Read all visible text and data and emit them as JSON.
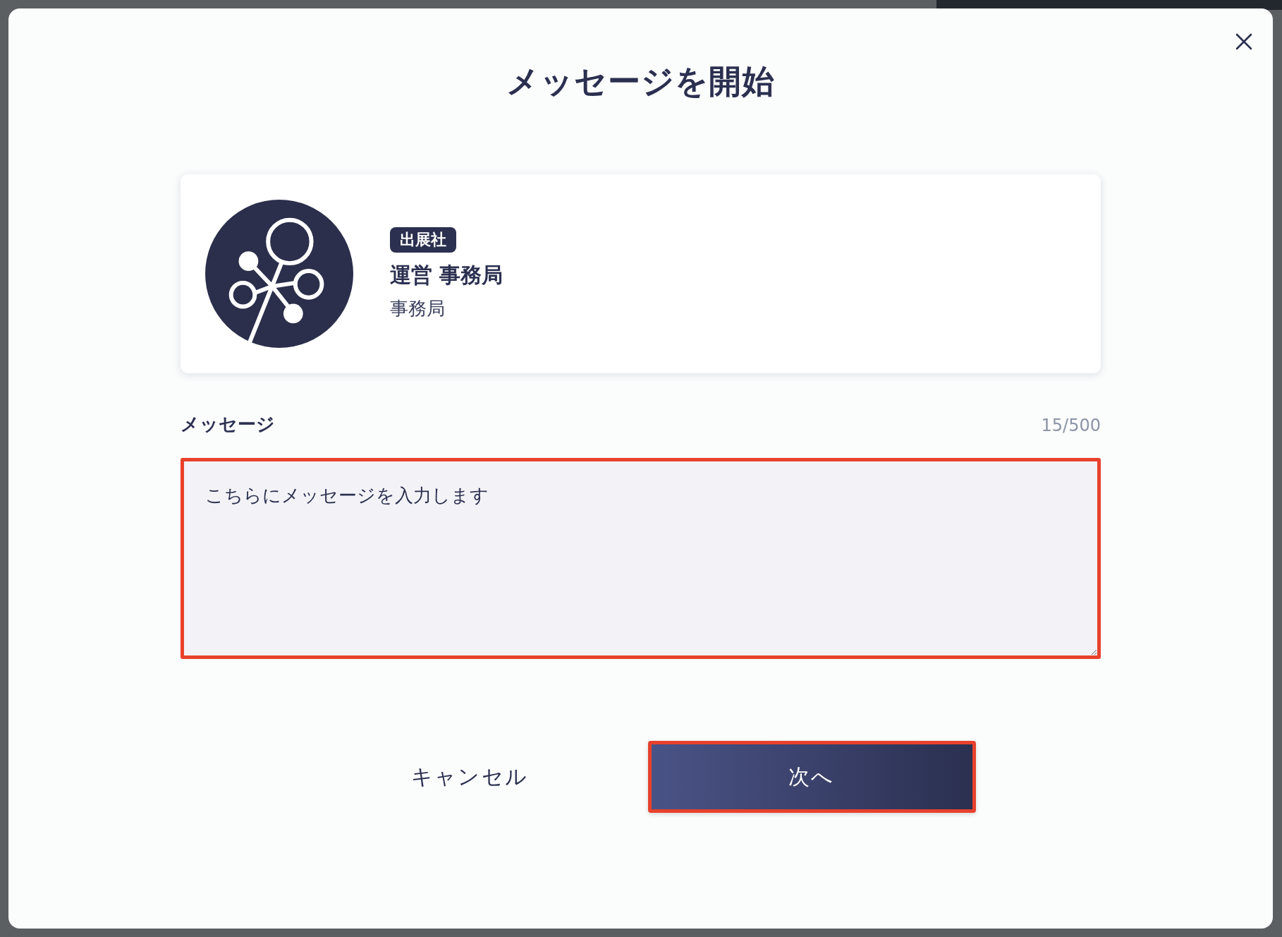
{
  "dialog": {
    "title": "メッセージを開始",
    "profile": {
      "badge": "出展社",
      "name": "運営 事務局",
      "department": "事務局"
    },
    "message": {
      "label": "メッセージ",
      "counter": "15/500",
      "value": "こちらにメッセージを入力します",
      "highlighted": true
    },
    "buttons": [
      {
        "kind": "text",
        "label": "キャンセル",
        "highlighted": false
      },
      {
        "kind": "primary",
        "label": "次へ",
        "highlighted": true
      }
    ]
  }
}
